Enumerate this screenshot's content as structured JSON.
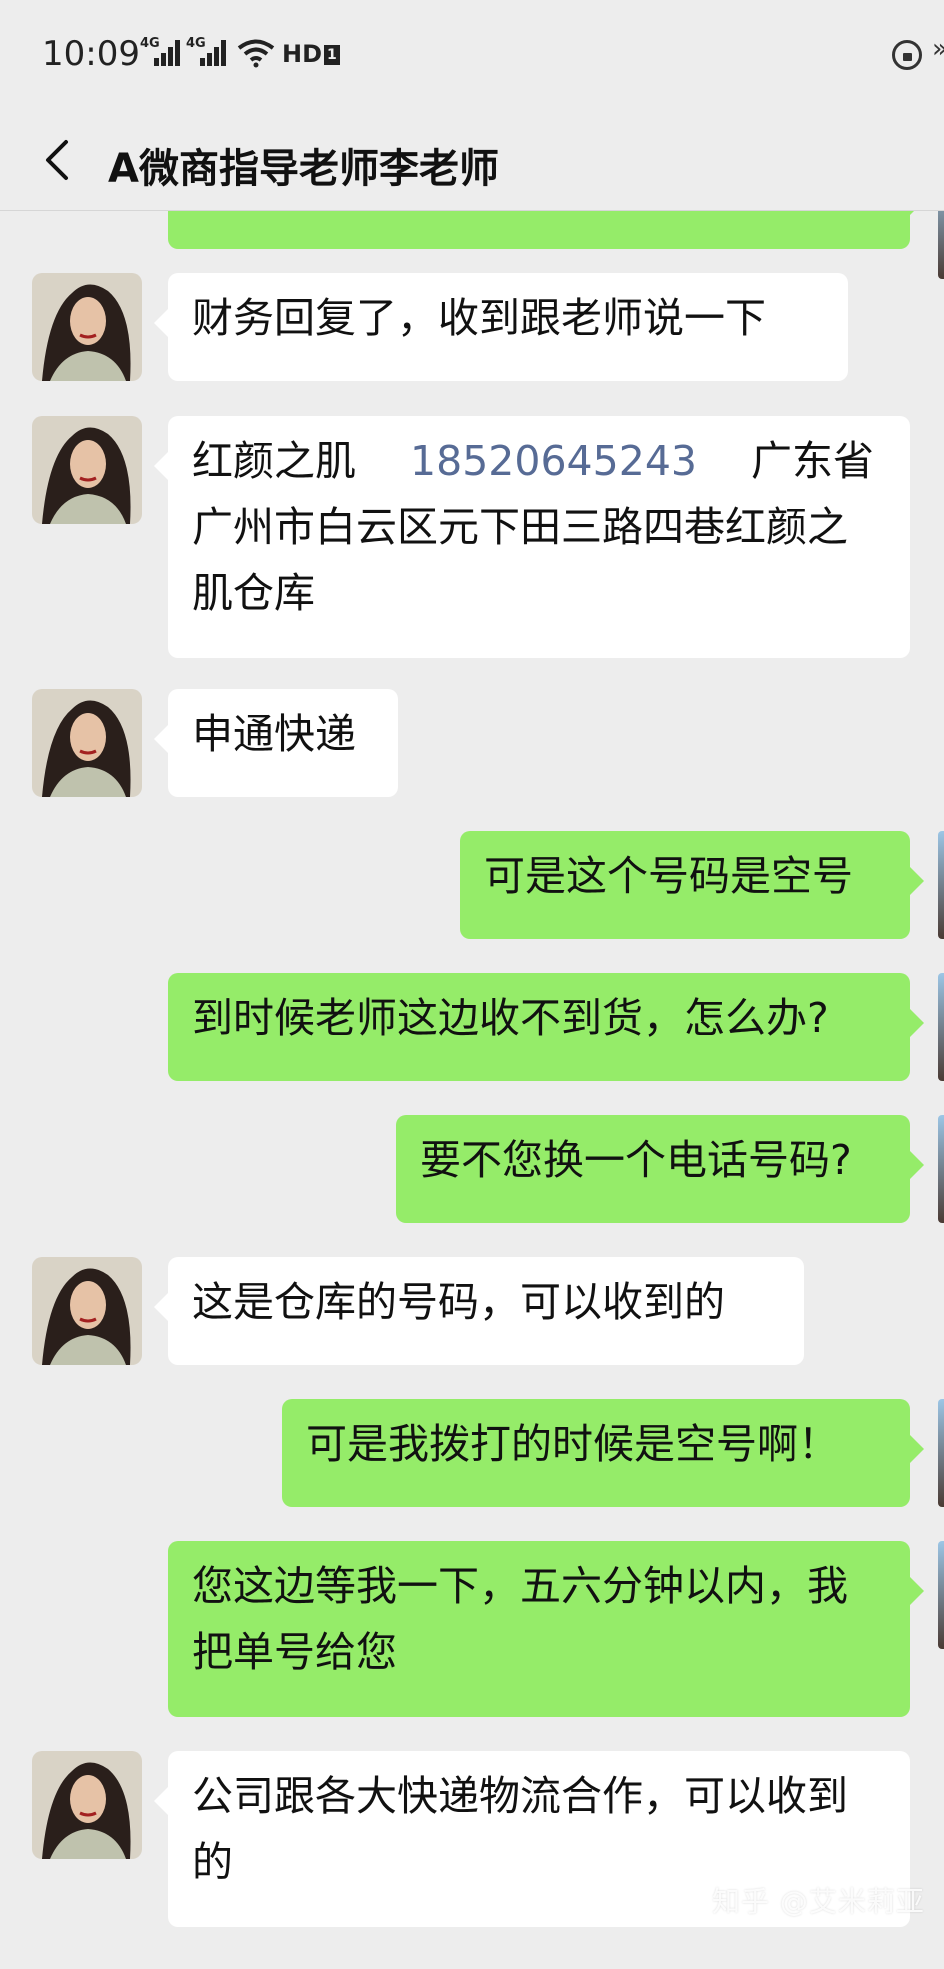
{
  "status": {
    "time": "10:09",
    "network1": "4G",
    "network2": "4G",
    "hd_label": "HD",
    "hd_sub": "1"
  },
  "header": {
    "title": "A微商指导老师李老师"
  },
  "messages": [
    {
      "side": "in",
      "text": "财务回复了，收到跟老师说一下"
    },
    {
      "side": "in",
      "parts": [
        "红颜之肌",
        "18520645243",
        "广东省广州市白云区元下田三路四巷红颜之肌仓库"
      ]
    },
    {
      "side": "in",
      "text": "申通快递"
    },
    {
      "side": "out",
      "text": "可是这个号码是空号"
    },
    {
      "side": "out",
      "text": "到时候老师这边收不到货，怎么办?"
    },
    {
      "side": "out",
      "text": "要不您换一个电话号码?"
    },
    {
      "side": "in",
      "text": "这是仓库的号码，可以收到的"
    },
    {
      "side": "out",
      "text": "可是我拨打的时候是空号啊！"
    },
    {
      "side": "out",
      "text": "您这边等我一下，五六分钟以内，我把单号给您"
    },
    {
      "side": "in",
      "text": "公司跟各大快递物流合作，可以收到的"
    }
  ],
  "watermark": "知乎 @艾米莉亚",
  "colors": {
    "background": "#ededed",
    "outgoing_bubble": "#95ec69",
    "incoming_bubble": "#ffffff",
    "link": "#576b95"
  }
}
